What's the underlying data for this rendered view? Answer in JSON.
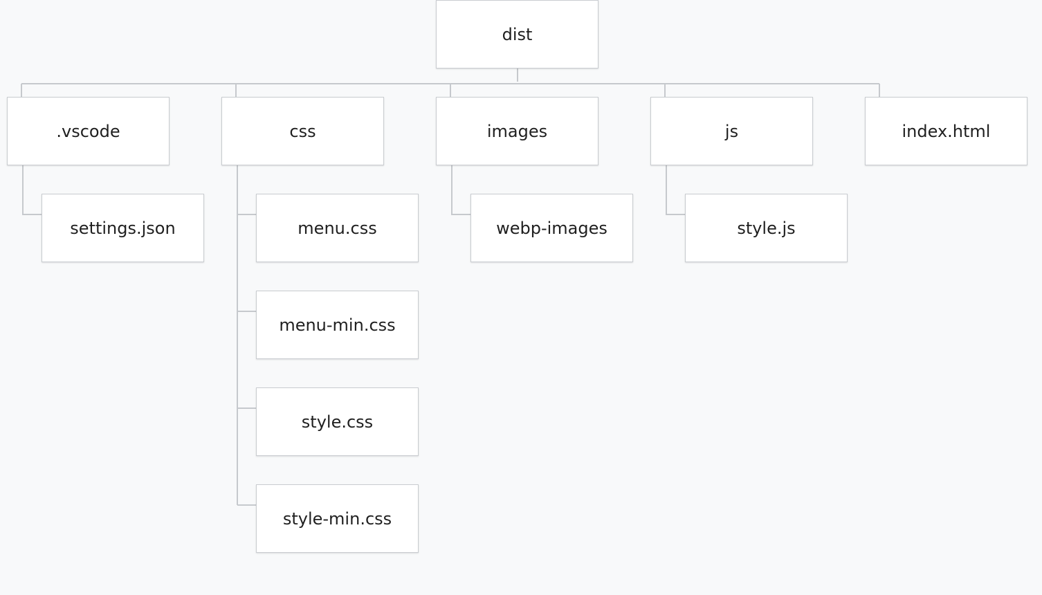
{
  "tree": {
    "root": {
      "label": "dist"
    },
    "folders": {
      "vscode": {
        "label": ".vscode",
        "children": [
          "settings.json"
        ]
      },
      "css": {
        "label": "css",
        "children": [
          "menu.css",
          "menu-min.css",
          "style.css",
          "style-min.css"
        ]
      },
      "images": {
        "label": "images",
        "children": [
          "webp-images"
        ]
      },
      "js": {
        "label": "js",
        "children": [
          "style.js"
        ]
      }
    },
    "files": {
      "index": {
        "label": "index.html"
      }
    }
  },
  "colors": {
    "background": "#f8f9fa",
    "node_fill": "#ffffff",
    "node_border": "#c9ccd0",
    "connector": "#c6c9cd",
    "text": "#1f1f1f"
  }
}
